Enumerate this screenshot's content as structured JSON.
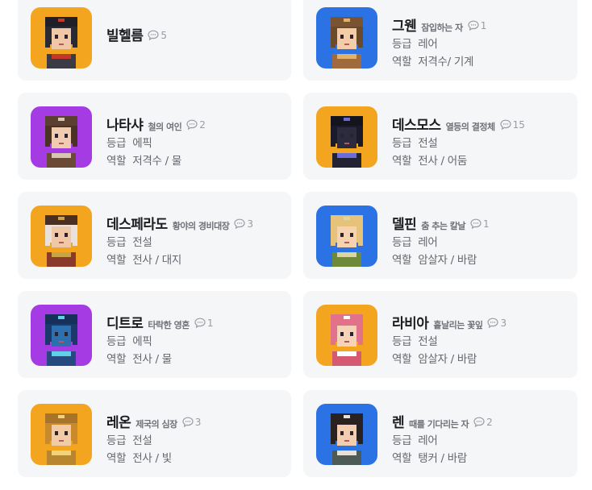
{
  "labels": {
    "grade": "등급",
    "role": "역할"
  },
  "characters": [
    {
      "name": "빌헬름",
      "subtitle": "",
      "comments": "5",
      "grade": "",
      "role": "",
      "avatar_bg": "#f4a51f",
      "avatar_theme": "dark-armor"
    },
    {
      "name": "그웬",
      "subtitle": "잠입하는 자",
      "comments": "1",
      "grade": "레어",
      "role": "저격수/ 기계",
      "avatar_bg": "#2b72e4",
      "avatar_theme": "goggles"
    },
    {
      "name": "나타샤",
      "subtitle": "철의 여인",
      "comments": "2",
      "grade": "에픽",
      "role": "저격수 / 물",
      "avatar_bg": "#a53be3",
      "avatar_theme": "fur-hat"
    },
    {
      "name": "데스모스",
      "subtitle": "열등의 결정체",
      "comments": "15",
      "grade": "전설",
      "role": "전사 / 어둠",
      "avatar_bg": "#f4a51f",
      "avatar_theme": "dark-knight"
    },
    {
      "name": "데스페라도",
      "subtitle": "황야의 경비대장",
      "comments": "3",
      "grade": "전설",
      "role": "전사 / 대지",
      "avatar_bg": "#f4a51f",
      "avatar_theme": "cowboy"
    },
    {
      "name": "델핀",
      "subtitle": "춤 추는 칼날",
      "comments": "1",
      "grade": "레어",
      "role": "암살자 / 바람",
      "avatar_bg": "#2b72e4",
      "avatar_theme": "elf"
    },
    {
      "name": "디트로",
      "subtitle": "타락한 영혼",
      "comments": "1",
      "grade": "에픽",
      "role": "전사 / 물",
      "avatar_bg": "#a53be3",
      "avatar_theme": "blue-knight"
    },
    {
      "name": "라비아",
      "subtitle": "흩날리는 꽃잎",
      "comments": "3",
      "grade": "전설",
      "role": "암살자 / 바람",
      "avatar_bg": "#f4a51f",
      "avatar_theme": "pink-hair"
    },
    {
      "name": "레온",
      "subtitle": "제국의 심장",
      "comments": "3",
      "grade": "전설",
      "role": "전사 / 빛",
      "avatar_bg": "#f4a51f",
      "avatar_theme": "golden-armor"
    },
    {
      "name": "렌",
      "subtitle": "때를 기다리는 자",
      "comments": "2",
      "grade": "레어",
      "role": "탱커 / 바람",
      "avatar_bg": "#2b72e4",
      "avatar_theme": "ponytail"
    }
  ]
}
